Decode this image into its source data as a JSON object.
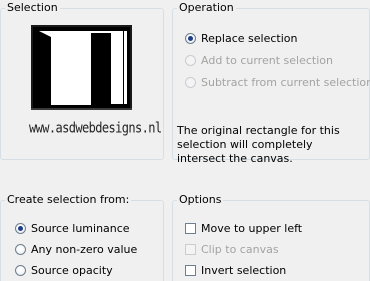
{
  "selection": {
    "legend": "Selection",
    "watermark": "www.asdwebdesigns.nl"
  },
  "operation": {
    "legend": "Operation",
    "options": [
      {
        "label": "Replace selection",
        "checked": true,
        "enabled": true
      },
      {
        "label": "Add to current selection",
        "checked": false,
        "enabled": false
      },
      {
        "label": "Subtract from current selection",
        "checked": false,
        "enabled": false
      }
    ],
    "description": "The original rectangle for this selection will completely intersect the canvas."
  },
  "create_from": {
    "legend": "Create selection from:",
    "options": [
      {
        "label": "Source luminance",
        "checked": true
      },
      {
        "label": "Any non-zero value",
        "checked": false
      },
      {
        "label": "Source opacity",
        "checked": false
      }
    ]
  },
  "options": {
    "legend": "Options",
    "items": [
      {
        "label": "Move to upper left",
        "checked": false,
        "enabled": true
      },
      {
        "label": "Clip to canvas",
        "checked": false,
        "enabled": false
      },
      {
        "label": "Invert selection",
        "checked": false,
        "enabled": true
      }
    ]
  }
}
